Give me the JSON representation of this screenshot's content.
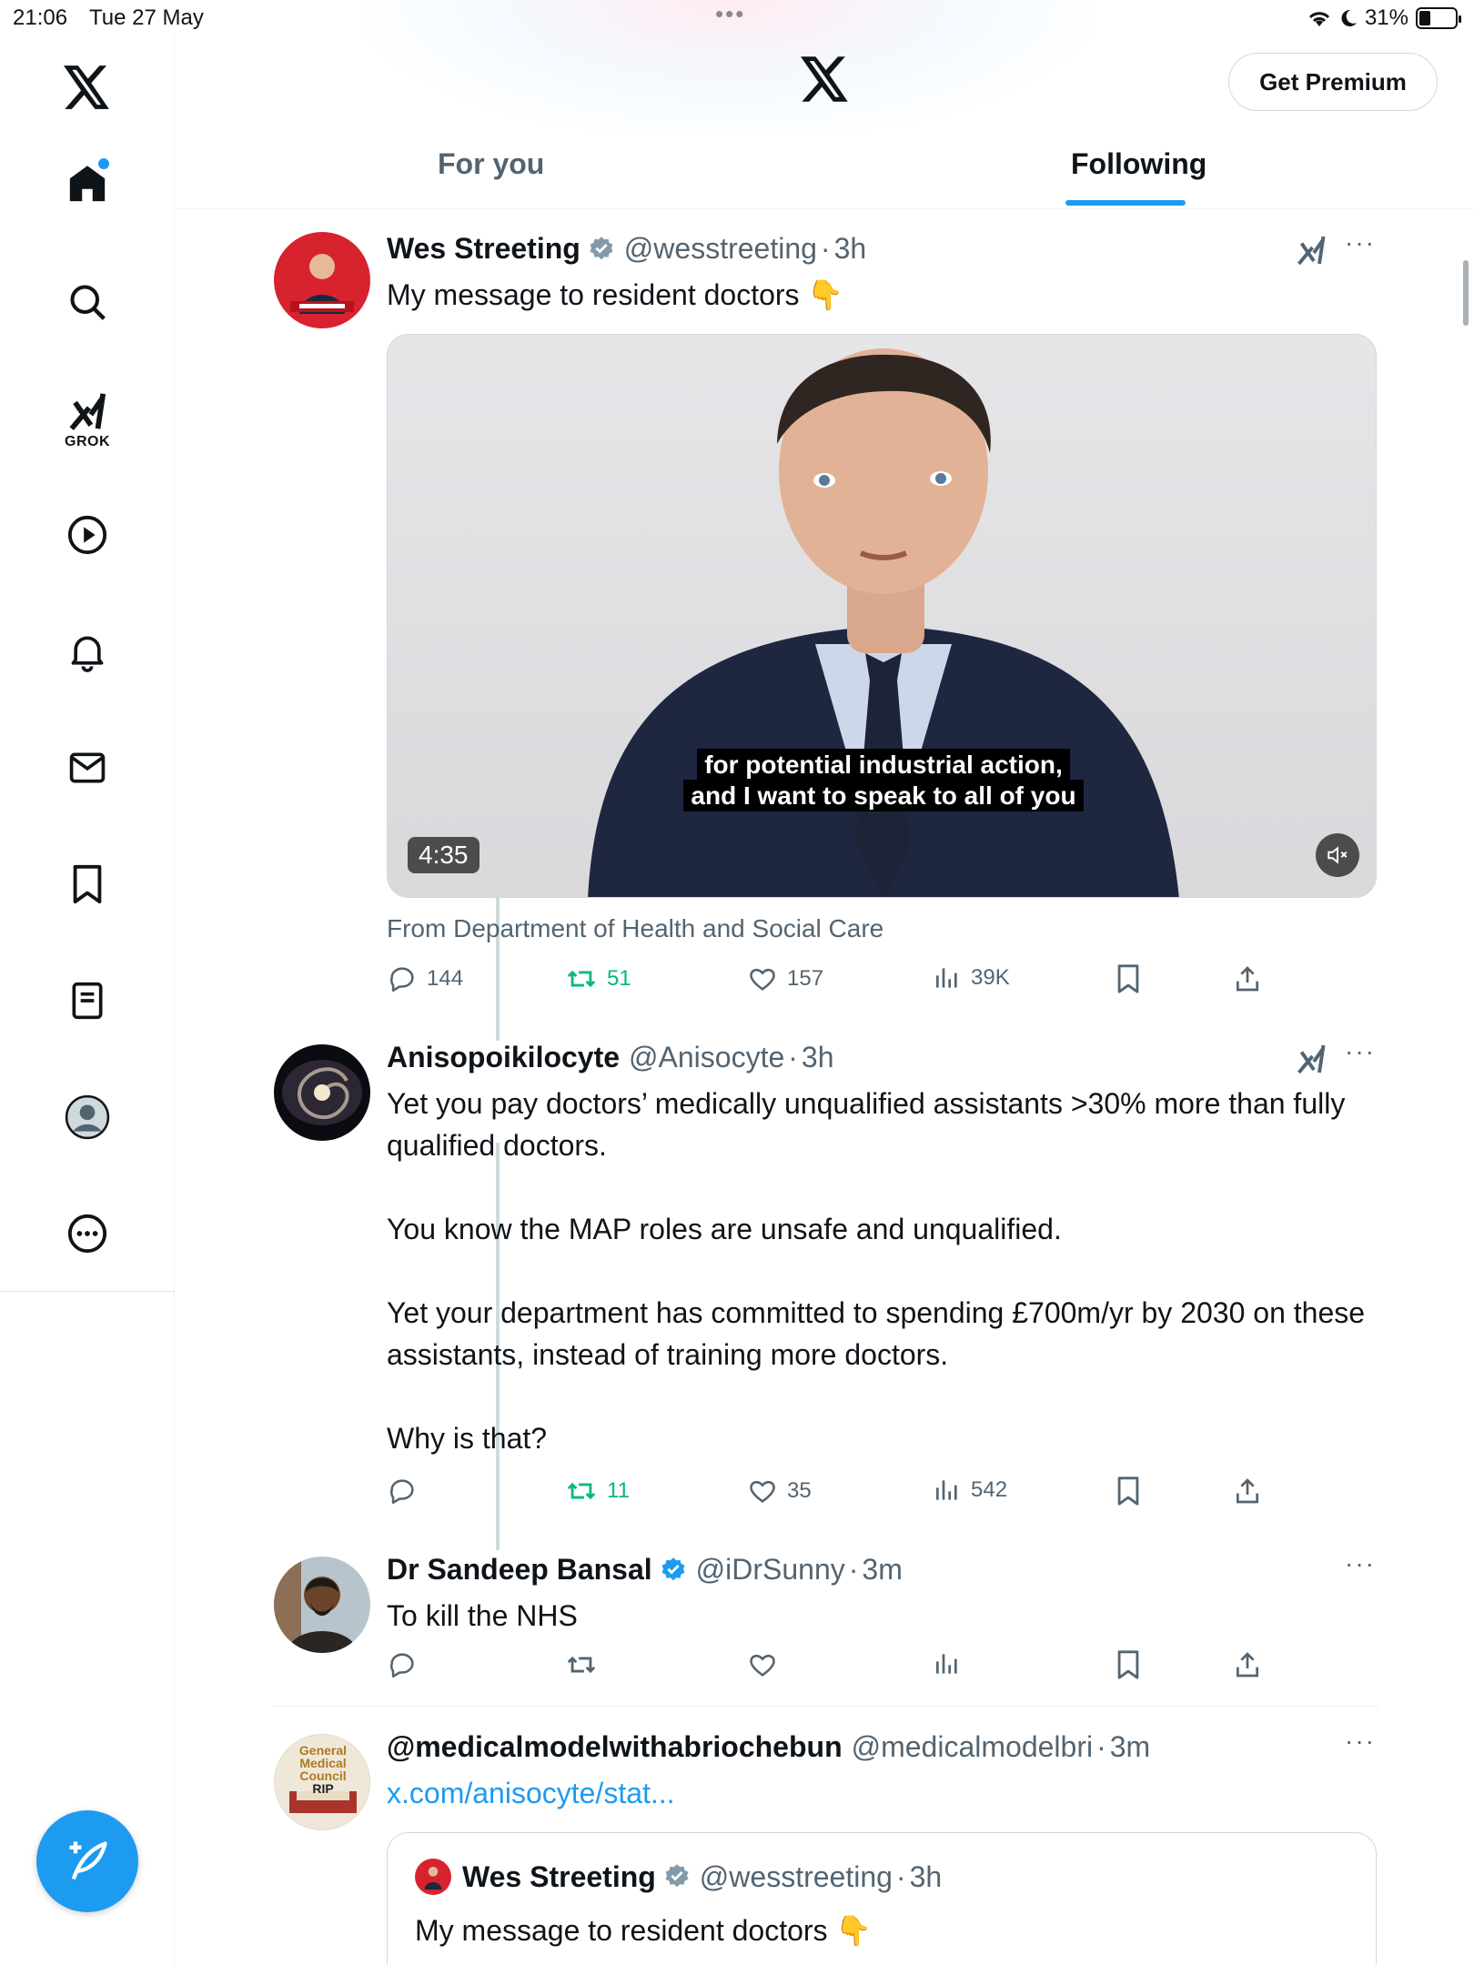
{
  "status_bar": {
    "time": "21:06",
    "date": "Tue 27 May",
    "battery": "31%"
  },
  "header": {
    "premium_label": "Get Premium"
  },
  "tabs": [
    {
      "label": "For you"
    },
    {
      "label": "Following"
    }
  ],
  "sidebar": {
    "grok_label": "GROK"
  },
  "tweets": [
    {
      "name": "Wes Streeting",
      "handle": "@wesstreeting",
      "time": "3h",
      "text": "My message to resident doctors 👇",
      "video": {
        "duration": "4:35",
        "caption_line1": "for potential industrial action,",
        "caption_line2": "and I want to speak to all of you"
      },
      "source": "From Department of Health and Social Care",
      "stats": {
        "replies": "144",
        "reposts": "51",
        "likes": "157",
        "views": "39K"
      }
    },
    {
      "name": "Anisopoikilocyte",
      "handle": "@Anisocyte",
      "time": "3h",
      "paragraphs": [
        "Yet you pay doctors’ medically unqualified assistants >30% more than fully qualified doctors.",
        "You know the MAP roles are unsafe and unqualified.",
        "Yet your department has committed to spending £700m/yr by 2030 on these assistants, instead of training more doctors.",
        "Why is that?"
      ],
      "stats": {
        "reposts": "11",
        "likes": "35",
        "views": "542"
      }
    },
    {
      "name": "Dr Sandeep Bansal",
      "handle": "@iDrSunny",
      "time": "3m",
      "text": "To kill the NHS"
    },
    {
      "name": "@medicalmodelwithabriochebun",
      "handle": "@medicalmodelbri",
      "time": "3m",
      "link": "x.com/anisocyte/stat...",
      "avatar_text": [
        "General",
        "Medical",
        "Council",
        "RIP"
      ],
      "quote": {
        "name": "Wes Streeting",
        "handle": "@wesstreeting",
        "time": "3h",
        "text": "My message to resident doctors 👇"
      }
    }
  ],
  "colors": {
    "accent": "#1d9bf0",
    "repost_green": "#00ba7c",
    "secondary_text": "#536471"
  }
}
